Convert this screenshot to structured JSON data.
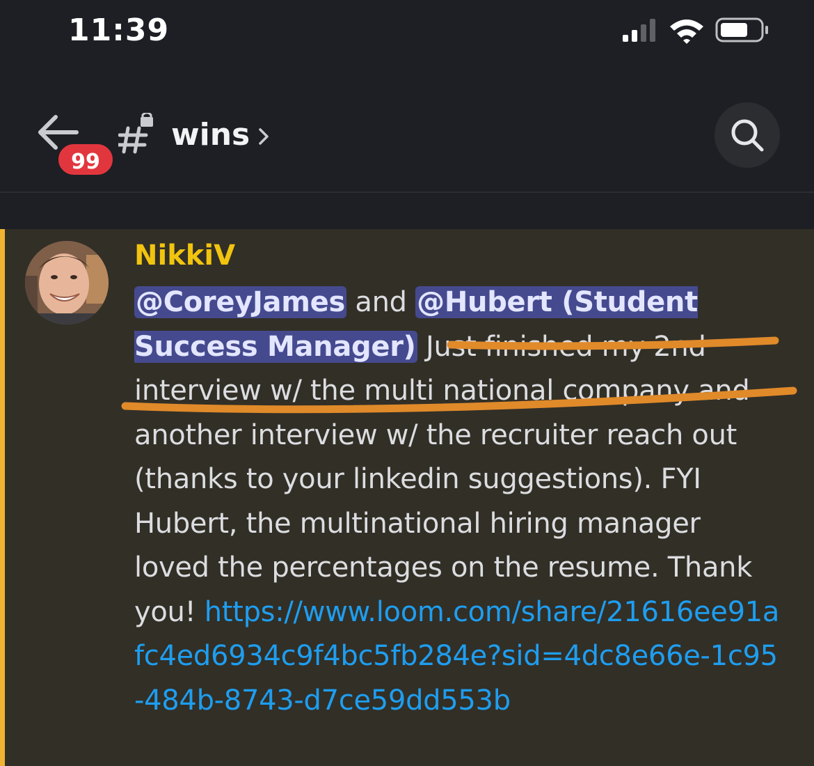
{
  "status_bar": {
    "time": "11:39"
  },
  "header": {
    "back_icon": "arrow-left-icon",
    "unread_badge": "99",
    "channel_icon": "hash-lock-icon",
    "channel_name": "wins",
    "chevron_icon": "chevron-right-icon",
    "search_icon": "search-icon"
  },
  "message": {
    "author": "NikkiV",
    "author_color": "#f1c40f",
    "mention_1": "@CoreyJames",
    "text_and": " and ",
    "mention_2": "@Hubert (Student Success Manager)",
    "body": " Just finished my 2nd interview w/ the multi national company and another interview w/ the recruiter reach out (thanks to your linkedin suggestions). FYI Hubert, the multinational hiring manager loved the percentages on the resume. Thank you! ",
    "link": "https://www.loom.com/share/21616ee91afc4ed6934c9f4bc5fb284e?sid=4dc8e66e-1c95-484b-8743-d7ce59dd553b",
    "highlight_color": "#f0b232",
    "annotation_color": "#e08a2a"
  }
}
